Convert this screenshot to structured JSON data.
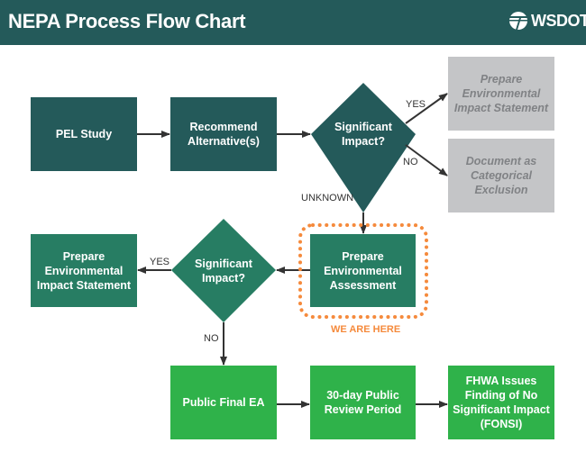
{
  "header": {
    "title": "NEPA Process Flow Chart",
    "logo_text": "WSDOT",
    "logo_icon": "wsdot-logo-icon"
  },
  "colors": {
    "header": "#245a5a",
    "dark_box": "#245a5a",
    "current_box": "#277d63",
    "future_box": "#2fb24a",
    "alternative_box": "#c4c5c7",
    "highlight": "#f58a3c"
  },
  "nodes": {
    "pel_study": "PEL Study",
    "recommend": "Recommend\nAlternative(s)",
    "decision1": "Significant\nImpact?",
    "prepare_eis_gray": "Prepare\nEnvironmental\nImpact Statement",
    "categorical_exclusion": "Document as\nCategorical\nExclusion",
    "prepare_ea": "Prepare\nEnvironmental\nAssessment",
    "decision2": "Significant\nImpact?",
    "prepare_eis": "Prepare\nEnvironmental\nImpact Statement",
    "public_final_ea": "Public Final EA",
    "review_period": "30-day Public\nReview Period",
    "fonsi": "FHWA Issues\nFinding of No\nSignificant Impact\n(FONSI)"
  },
  "edge_labels": {
    "d1_yes": "YES",
    "d1_no": "NO",
    "d1_unknown": "UNKNOWN",
    "d2_yes": "YES",
    "d2_no": "NO"
  },
  "highlight_label": "WE ARE HERE"
}
